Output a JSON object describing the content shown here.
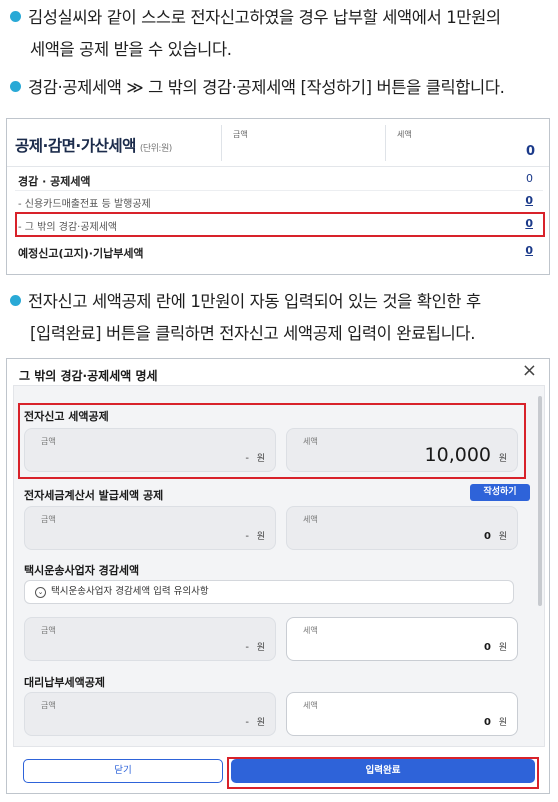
{
  "instructions": {
    "step1_line1": "김성실씨와 같이 스스로 전자신고하였을 경우 납부할 세액에서 1만원의",
    "step1_line2": "세액을 공제 받을 수 있습니다.",
    "step2": "경감·공제세액 ≫ 그 밖의 경감·공제세액 [작성하기] 버튼을 클릭합니다.",
    "step3_line1": "전자신고 세액공제 란에 1만원이 자동 입력되어 있는 것을 확인한 후",
    "step3_line2": "[입력완료] 버튼을 클릭하면 전자신고 세액공제 입력이 완료됩니다."
  },
  "deduction_panel": {
    "title": "공제·감면·가산세액",
    "unit": "(단위:원)",
    "col_amount": "금액",
    "col_tax": "세액",
    "total": "0",
    "rows": [
      {
        "label": "경감 · 공제세액",
        "value": "0"
      },
      {
        "label": "- 신용카드매출전표 등 발행공제",
        "value": "0"
      },
      {
        "label": "- 그 밖의 경감·공제세액",
        "value": "0"
      },
      {
        "label": "예정신고(고지)·기납부세액",
        "value": "0"
      }
    ]
  },
  "modal": {
    "title": "그 밖의 경감·공제세액 명세",
    "close_icon": "×",
    "sections": {
      "e_filing": {
        "label": "전자신고 세액공제",
        "amount_caption": "금액",
        "amount_value": "-",
        "amount_unit": "원",
        "tax_caption": "세액",
        "tax_value": "10,000",
        "tax_unit": "원"
      },
      "e_invoice": {
        "label": "전자세금계산서 발급세액 공제",
        "write_button": "작성하기",
        "amount_caption": "금액",
        "amount_value": "-",
        "amount_unit": "원",
        "tax_caption": "세액",
        "tax_value": "0",
        "tax_unit": "원"
      },
      "taxi": {
        "label": "택시운송사업자 경감세액",
        "notice": "택시운송사업자 경감세액 입력 유의사항",
        "amount_caption": "금액",
        "amount_value": "-",
        "amount_unit": "원",
        "tax_caption": "세액",
        "tax_value": "0",
        "tax_unit": "원"
      },
      "proxy": {
        "label": "대리납부세액공제",
        "amount_caption": "금액",
        "amount_value": "-",
        "amount_unit": "원",
        "tax_caption": "세액",
        "tax_value": "0",
        "tax_unit": "원"
      }
    },
    "close_button": "닫기",
    "submit_button": "입력완료"
  },
  "colors": {
    "bullet": "#29a9d6",
    "primary": "#2e63d9",
    "highlight": "#d8222a"
  }
}
